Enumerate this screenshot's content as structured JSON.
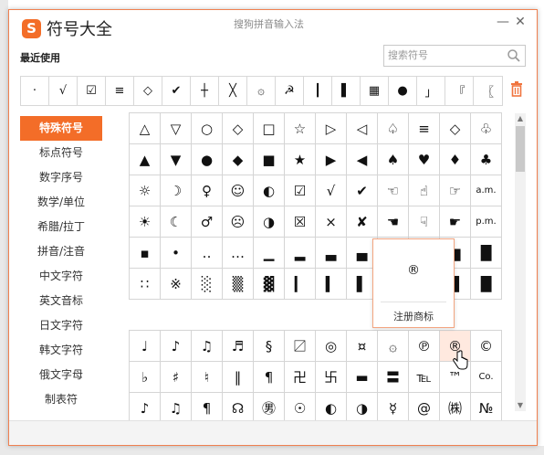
{
  "window": {
    "logo_letter": "S",
    "title": "符号大全",
    "subtitle": "搜狗拼音输入法",
    "minimize": "—",
    "close": "✕"
  },
  "colors": {
    "accent": "#f36d28",
    "border": "#f08050"
  },
  "recent": {
    "label": "最近使用",
    "items": [
      "·",
      "√",
      "☑",
      "≡",
      "◇",
      "✔",
      "┼",
      "╳",
      "۞",
      "☭",
      "┃",
      "▌",
      "▦",
      "●",
      "」",
      "『",
      "〖"
    ],
    "delete_icon": "trash-icon"
  },
  "search": {
    "placeholder": "搜索符号",
    "value": ""
  },
  "categories": [
    {
      "label": "特殊符号",
      "active": true
    },
    {
      "label": "标点符号"
    },
    {
      "label": "数字序号"
    },
    {
      "label": "数学/单位"
    },
    {
      "label": "希腊/拉丁"
    },
    {
      "label": "拼音/注音"
    },
    {
      "label": "中文字符"
    },
    {
      "label": "英文音标"
    },
    {
      "label": "日文字符"
    },
    {
      "label": "韩文字符"
    },
    {
      "label": "俄文字母"
    },
    {
      "label": "制表符"
    }
  ],
  "grid1": [
    [
      "△",
      "▽",
      "○",
      "◇",
      "□",
      "☆",
      "▷",
      "◁",
      "♤",
      "≡",
      "◇",
      "♧"
    ],
    [
      "▲",
      "▼",
      "●",
      "◆",
      "■",
      "★",
      "▶",
      "◀",
      "♠",
      "♥",
      "♦",
      "♣"
    ],
    [
      "☼",
      "☽",
      "♀",
      "☺",
      "◐",
      "☑",
      "√",
      "✔",
      "☜",
      "☝",
      "☞",
      "a.m."
    ],
    [
      "☀",
      "☾",
      "♂",
      "☹",
      "◑",
      "☒",
      "×",
      "✘",
      "☚",
      "☟",
      "☛",
      "p.m."
    ],
    [
      "▪",
      "•",
      "‥",
      "…",
      "▁",
      "▂",
      "▃",
      "▄",
      "",
      "",
      "▆",
      "█"
    ],
    [
      "∷",
      "※",
      "░",
      "▒",
      "▓",
      "▎",
      "▍",
      "▌",
      "",
      "",
      "▉",
      "█"
    ]
  ],
  "grid2": [
    [
      "♩",
      "♪",
      "♫",
      "♬",
      "§",
      "〼",
      "◎",
      "¤",
      "۞",
      "℗",
      "®",
      "©"
    ],
    [
      "♭",
      "♯",
      "♮",
      "‖",
      "¶",
      "卍",
      "卐",
      "▬",
      "〓",
      "℡",
      "™",
      "Co."
    ],
    [
      "♪",
      "♫",
      "¶",
      "☊",
      "㊚",
      "☉",
      "◐",
      "◑",
      "☿",
      "@",
      "㈱",
      "№"
    ]
  ],
  "tooltip": {
    "symbol": "®",
    "label": "注册商标"
  }
}
